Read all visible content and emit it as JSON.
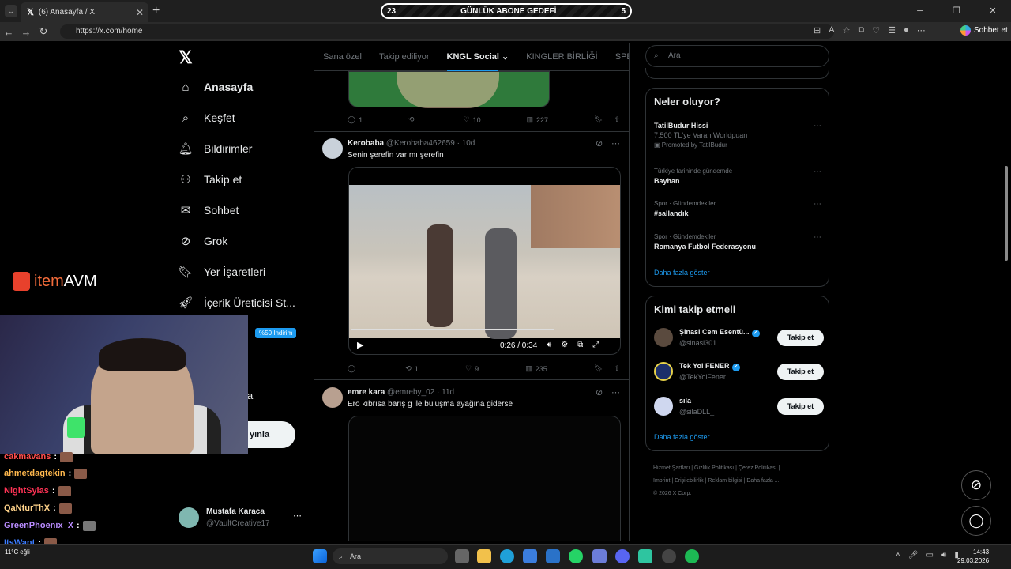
{
  "browser": {
    "tab_title": "(6) Anasayfa / X",
    "url": "https://x.com/home",
    "copilot_label": "Sohbet et"
  },
  "stream_goal": {
    "left": "23",
    "title": "GÜNLÜK ABONE GEDEFİ",
    "right": "5"
  },
  "nav": {
    "items": [
      {
        "label": "Anasayfa",
        "icon": "home-icon"
      },
      {
        "label": "Keşfet",
        "icon": "search-icon"
      },
      {
        "label": "Bildirimler",
        "icon": "bell-icon"
      },
      {
        "label": "Takip et",
        "icon": "add-person-icon"
      },
      {
        "label": "Sohbet",
        "icon": "mail-icon"
      },
      {
        "label": "Grok",
        "icon": "grok-icon"
      },
      {
        "label": "Yer İşaretleri",
        "icon": "bookmark-icon"
      },
      {
        "label": "İçerik Üreticisi St...",
        "icon": "rocket-icon"
      }
    ],
    "post_button": "yınla",
    "partial_label": "a",
    "profile": {
      "name": "Mustafa Karaca",
      "handle": "@VaultCreative17"
    }
  },
  "feed_tabs": [
    "Sana özel",
    "Takip ediliyor",
    "KNGL Social",
    "KINGLER BİRLİĞİ",
    "SPEED G"
  ],
  "tweets": [
    {
      "replies": "1",
      "retweets": "",
      "likes": "10",
      "views": "227"
    },
    {
      "name": "Kerobaba",
      "handle": "@Kerobaba462659",
      "time": "10d",
      "text": "Senin şerefin var mı şerefin",
      "video_time": "0:26 / 0:34",
      "replies": "",
      "retweets": "1",
      "likes": "9",
      "views": "235"
    },
    {
      "name": "emre kara",
      "handle": "@emreby_02",
      "time": "11d",
      "text": "Ero kıbrısa barış g ile buluşma ayağına giderse"
    }
  ],
  "search": {
    "placeholder": "Ara"
  },
  "trends": {
    "title": "Neler oluyor?",
    "items": [
      {
        "meta": "",
        "name": "TatilBudur Hissi",
        "sub": "7.500 TL'ye Varan Worldpuan",
        "promo": "Promoted by TatilBudur"
      },
      {
        "meta": "Türkiye tarihinde gündemde",
        "name": "Bayhan",
        "sub": "",
        "promo": ""
      },
      {
        "meta": "Spor · Gündemdekiler",
        "name": "#sallandık",
        "sub": "",
        "promo": ""
      },
      {
        "meta": "Spor · Gündemdekiler",
        "name": "Romanya Futbol Federasyonu",
        "sub": "",
        "promo": ""
      }
    ],
    "show_more": "Daha fazla göster"
  },
  "who_to_follow": {
    "title": "Kimi takip etmeli",
    "users": [
      {
        "name": "Şinasi Cem Esentü...",
        "handle": "@sinasi301",
        "button": "Takip et"
      },
      {
        "name": "Tek Yol FENER",
        "handle": "@TekYolFener",
        "button": "Takip et"
      },
      {
        "name": "sıla",
        "handle": "@silaDLL_",
        "button": "Takip et"
      }
    ],
    "show_more": "Daha fazla göster"
  },
  "footer": {
    "links": [
      "Hizmet Şartları",
      "Gizlilik Politikası",
      "Çerez Politikası",
      "Imprint",
      "Erişilebilirlik",
      "Reklam bilgisi",
      "Daha fazla ..."
    ],
    "copyright": "© 2026 X Corp."
  },
  "overlay": {
    "brand_item": "item",
    "brand_avm": "AVM",
    "promo": "%50 İndirim",
    "chat": [
      {
        "user": "cakmavans",
        "color": "#ff4d4d"
      },
      {
        "user": "ahmetdagtekin",
        "color": "#ffb84d"
      },
      {
        "user": "NightSylas",
        "color": "#ff3355"
      },
      {
        "user": "QaNturThX",
        "color": "#ffd38a"
      },
      {
        "user": "GreenPhoenix_X",
        "color": "#b98cff"
      },
      {
        "user": "ItsWant",
        "color": "#3d7dff"
      }
    ],
    "weather": "11°C",
    "weather_label": "eğli"
  },
  "taskbar": {
    "search": "Ara",
    "time": "14:43",
    "date": "29.03.2026"
  }
}
